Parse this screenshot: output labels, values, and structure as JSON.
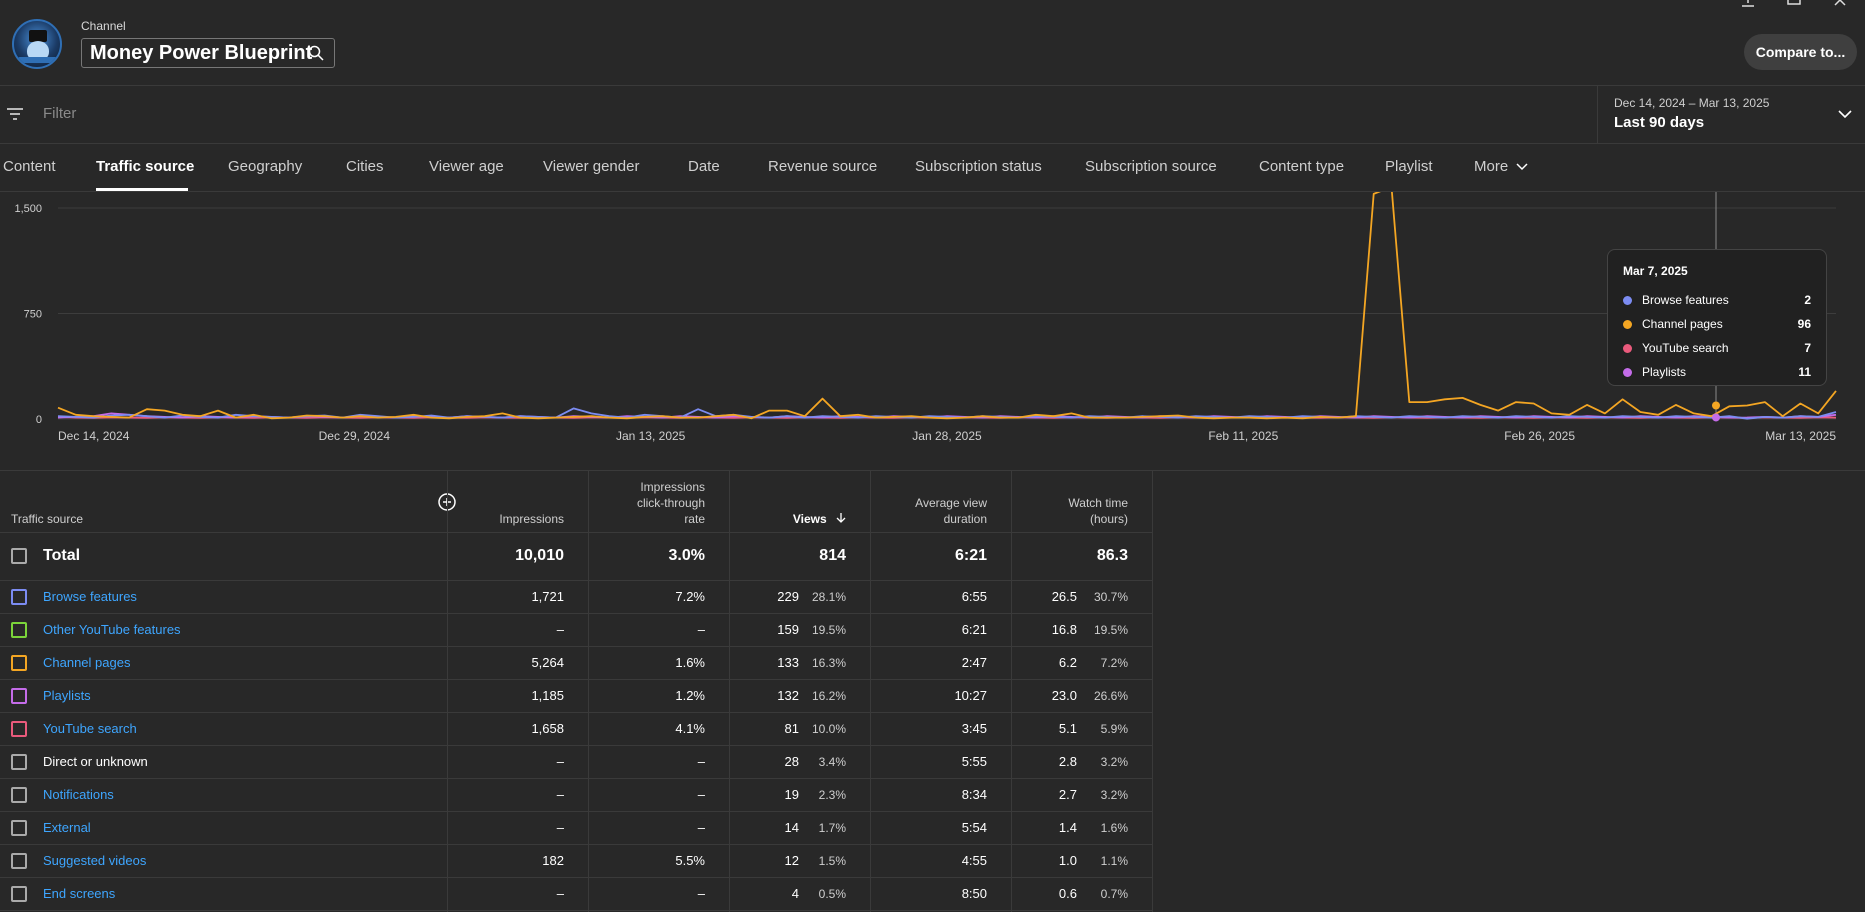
{
  "header": {
    "channel_label": "Channel",
    "channel_name": "Money Power Blueprint",
    "compare_label": "Compare to..."
  },
  "filter": {
    "placeholder": "Filter"
  },
  "date": {
    "range": "Dec 14, 2024 – Mar 13, 2025",
    "label": "Last 90 days"
  },
  "tabs": [
    "Content",
    "Traffic source",
    "Geography",
    "Cities",
    "Viewer age",
    "Viewer gender",
    "Date",
    "Revenue source",
    "Subscription status",
    "Subscription source",
    "Content type",
    "Playlist",
    "More"
  ],
  "colors": {
    "browse": "#7c8cf2",
    "other": "#7bd43a",
    "channel": "#f4a623",
    "playlists": "#c46ce9",
    "search": "#ea5a7c",
    "neutral": "#aaaaaa"
  },
  "chart_data": {
    "type": "line",
    "x_ticks": [
      "Dec 14, 2024",
      "Dec 29, 2024",
      "Jan 13, 2025",
      "Jan 28, 2025",
      "Feb 11, 2025",
      "Feb 26, 2025",
      "Mar 13, 2025"
    ],
    "y_ticks": [
      "1,500",
      "750",
      "0"
    ],
    "ylim": [
      0,
      1500
    ],
    "grid": true,
    "series": [
      {
        "name": "Channel pages",
        "color": "#f4a623",
        "values": [
          80,
          30,
          20,
          15,
          10,
          70,
          60,
          30,
          20,
          60,
          10,
          30,
          5,
          10,
          25,
          20,
          10,
          20,
          10,
          15,
          30,
          10,
          5,
          15,
          20,
          40,
          10,
          5,
          10,
          15,
          20,
          10,
          5,
          15,
          20,
          10,
          10,
          20,
          30,
          5,
          60,
          60,
          20,
          145,
          20,
          30,
          10,
          15,
          20,
          10,
          5,
          10,
          20,
          10,
          10,
          30,
          20,
          40,
          10,
          10,
          10,
          15,
          20,
          25,
          10,
          5,
          10,
          10,
          5,
          10,
          5,
          15,
          10,
          20,
          1600,
          1650,
          120,
          120,
          140,
          150,
          100,
          60,
          120,
          110,
          40,
          30,
          100,
          40,
          140,
          50,
          30,
          100,
          40,
          20,
          90,
          96,
          120,
          20,
          110,
          40,
          200
        ]
      },
      {
        "name": "Browse features",
        "color": "#7c8cf2",
        "values": [
          20,
          15,
          10,
          25,
          30,
          20,
          10,
          25,
          15,
          10,
          30,
          20,
          15,
          10,
          20,
          25,
          10,
          30,
          20,
          10,
          15,
          25,
          10,
          20,
          15,
          10,
          20,
          15,
          10,
          75,
          40,
          20,
          10,
          30,
          20,
          10,
          70,
          20,
          30,
          15,
          10,
          20,
          10,
          20,
          15,
          10,
          20,
          15,
          10,
          20,
          15,
          10,
          20,
          15,
          10,
          20,
          15,
          10,
          20,
          15,
          10,
          20,
          15,
          10,
          20,
          15,
          10,
          20,
          15,
          10,
          20,
          15,
          10,
          20,
          15,
          10,
          20,
          15,
          10,
          20,
          15,
          10,
          20,
          15,
          10,
          20,
          15,
          10,
          20,
          15,
          10,
          20,
          15,
          10,
          20,
          2,
          15,
          10,
          20,
          15,
          50
        ]
      },
      {
        "name": "Playlists",
        "color": "#c46ce9",
        "values": [
          10,
          15,
          20,
          40,
          30,
          20,
          15,
          10,
          20,
          15,
          10,
          20,
          15,
          10,
          20,
          15,
          10,
          20,
          15,
          10,
          20,
          15,
          10,
          20,
          15,
          10,
          20,
          15,
          10,
          20,
          15,
          10,
          20,
          15,
          10,
          20,
          15,
          10,
          20,
          15,
          10,
          20,
          15,
          10,
          20,
          15,
          10,
          20,
          15,
          10,
          20,
          15,
          10,
          20,
          15,
          10,
          20,
          15,
          10,
          20,
          15,
          10,
          20,
          15,
          10,
          20,
          15,
          10,
          20,
          15,
          10,
          20,
          15,
          10,
          20,
          15,
          10,
          20,
          15,
          10,
          20,
          15,
          10,
          20,
          15,
          10,
          20,
          15,
          10,
          20,
          15,
          10,
          20,
          15,
          10,
          11,
          15,
          10,
          20,
          15,
          30
        ]
      },
      {
        "name": "YouTube search",
        "color": "#ea5a7c",
        "values": [
          15,
          10,
          8,
          12,
          10,
          8,
          12,
          10,
          8,
          12,
          10,
          8,
          12,
          10,
          8,
          12,
          10,
          8,
          12,
          10,
          8,
          12,
          10,
          8,
          12,
          10,
          8,
          12,
          10,
          8,
          12,
          10,
          8,
          12,
          10,
          8,
          12,
          10,
          8,
          12,
          10,
          8,
          12,
          10,
          8,
          12,
          10,
          8,
          12,
          10,
          8,
          12,
          10,
          8,
          12,
          10,
          8,
          12,
          10,
          8,
          12,
          10,
          8,
          12,
          10,
          8,
          12,
          10,
          8,
          12,
          10,
          8,
          12,
          10,
          8,
          12,
          10,
          8,
          12,
          10,
          8,
          12,
          10,
          8,
          12,
          10,
          8,
          12,
          10,
          8,
          12,
          10,
          8,
          12,
          10,
          7,
          12,
          10,
          8,
          12,
          10
        ]
      }
    ]
  },
  "tooltip": {
    "date": "Mar 7, 2025",
    "rows": [
      {
        "name": "Browse features",
        "value": "2",
        "color": "#7c8cf2"
      },
      {
        "name": "Channel pages",
        "value": "96",
        "color": "#f4a623"
      },
      {
        "name": "YouTube search",
        "value": "7",
        "color": "#ea5a7c"
      },
      {
        "name": "Playlists",
        "value": "11",
        "color": "#c46ce9"
      }
    ]
  },
  "table": {
    "headers": {
      "source": "Traffic source",
      "impressions": "Impressions",
      "ctr_1": "Impressions",
      "ctr_2": "click-through",
      "ctr_3": "rate",
      "views": "Views",
      "avd_1": "Average view",
      "avd_2": "duration",
      "wt_1": "Watch time",
      "wt_2": "(hours)"
    },
    "total": {
      "label": "Total",
      "impressions": "10,010",
      "ctr": "3.0%",
      "views": "814",
      "avd": "6:21",
      "watch": "86.3"
    },
    "rows": [
      {
        "source": "Browse features",
        "color": "#7c8cf2",
        "link": true,
        "impressions": "1,721",
        "ctr": "7.2%",
        "views": "229",
        "views_pct": "28.1%",
        "avd": "6:55",
        "watch": "26.5",
        "watch_pct": "30.7%"
      },
      {
        "source": "Other YouTube features",
        "color": "#7bd43a",
        "link": true,
        "impressions": "–",
        "ctr": "–",
        "views": "159",
        "views_pct": "19.5%",
        "avd": "6:21",
        "watch": "16.8",
        "watch_pct": "19.5%"
      },
      {
        "source": "Channel pages",
        "color": "#f4a623",
        "link": true,
        "impressions": "5,264",
        "ctr": "1.6%",
        "views": "133",
        "views_pct": "16.3%",
        "avd": "2:47",
        "watch": "6.2",
        "watch_pct": "7.2%"
      },
      {
        "source": "Playlists",
        "color": "#c46ce9",
        "link": true,
        "impressions": "1,185",
        "ctr": "1.2%",
        "views": "132",
        "views_pct": "16.2%",
        "avd": "10:27",
        "watch": "23.0",
        "watch_pct": "26.6%"
      },
      {
        "source": "YouTube search",
        "color": "#ea5a7c",
        "link": true,
        "impressions": "1,658",
        "ctr": "4.1%",
        "views": "81",
        "views_pct": "10.0%",
        "avd": "3:45",
        "watch": "5.1",
        "watch_pct": "5.9%"
      },
      {
        "source": "Direct or unknown",
        "color": "#aaaaaa",
        "link": false,
        "impressions": "–",
        "ctr": "–",
        "views": "28",
        "views_pct": "3.4%",
        "avd": "5:55",
        "watch": "2.8",
        "watch_pct": "3.2%"
      },
      {
        "source": "Notifications",
        "color": "#aaaaaa",
        "link": true,
        "impressions": "–",
        "ctr": "–",
        "views": "19",
        "views_pct": "2.3%",
        "avd": "8:34",
        "watch": "2.7",
        "watch_pct": "3.2%"
      },
      {
        "source": "External",
        "color": "#aaaaaa",
        "link": true,
        "impressions": "–",
        "ctr": "–",
        "views": "14",
        "views_pct": "1.7%",
        "avd": "5:54",
        "watch": "1.4",
        "watch_pct": "1.6%"
      },
      {
        "source": "Suggested videos",
        "color": "#aaaaaa",
        "link": true,
        "impressions": "182",
        "ctr": "5.5%",
        "views": "12",
        "views_pct": "1.5%",
        "avd": "4:55",
        "watch": "1.0",
        "watch_pct": "1.1%"
      },
      {
        "source": "End screens",
        "color": "#aaaaaa",
        "link": true,
        "impressions": "–",
        "ctr": "–",
        "views": "4",
        "views_pct": "0.5%",
        "avd": "8:50",
        "watch": "0.6",
        "watch_pct": "0.7%"
      }
    ]
  }
}
